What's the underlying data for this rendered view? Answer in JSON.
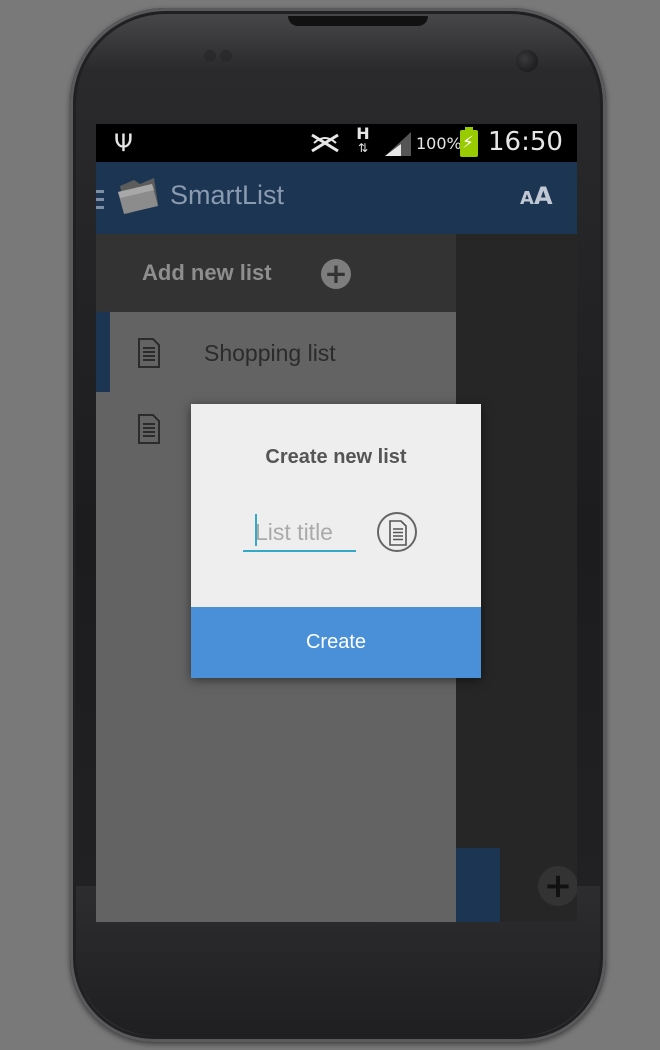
{
  "status_bar": {
    "usb_symbol": "Ψ",
    "network_type": "H",
    "network_arrows": "⇅",
    "battery_percent": "100%",
    "time": "16:50"
  },
  "action_bar": {
    "app_title": "SmartList",
    "font_size_small": "A",
    "font_size_large": "A"
  },
  "drawer": {
    "header_label": "Add new list",
    "add_symbol": "+",
    "items": [
      {
        "label": "Shopping list",
        "active": true
      },
      {
        "label": "",
        "active": false
      }
    ]
  },
  "fab": {
    "symbol": "+"
  },
  "dialog": {
    "title": "Create new list",
    "input": {
      "value": "",
      "placeholder": "List title"
    },
    "create_label": "Create"
  },
  "colors": {
    "action_bar": "#1b3553",
    "dialog_button": "#4a90d9",
    "input_underline": "#33a9c7",
    "battery": "#99cc00"
  }
}
